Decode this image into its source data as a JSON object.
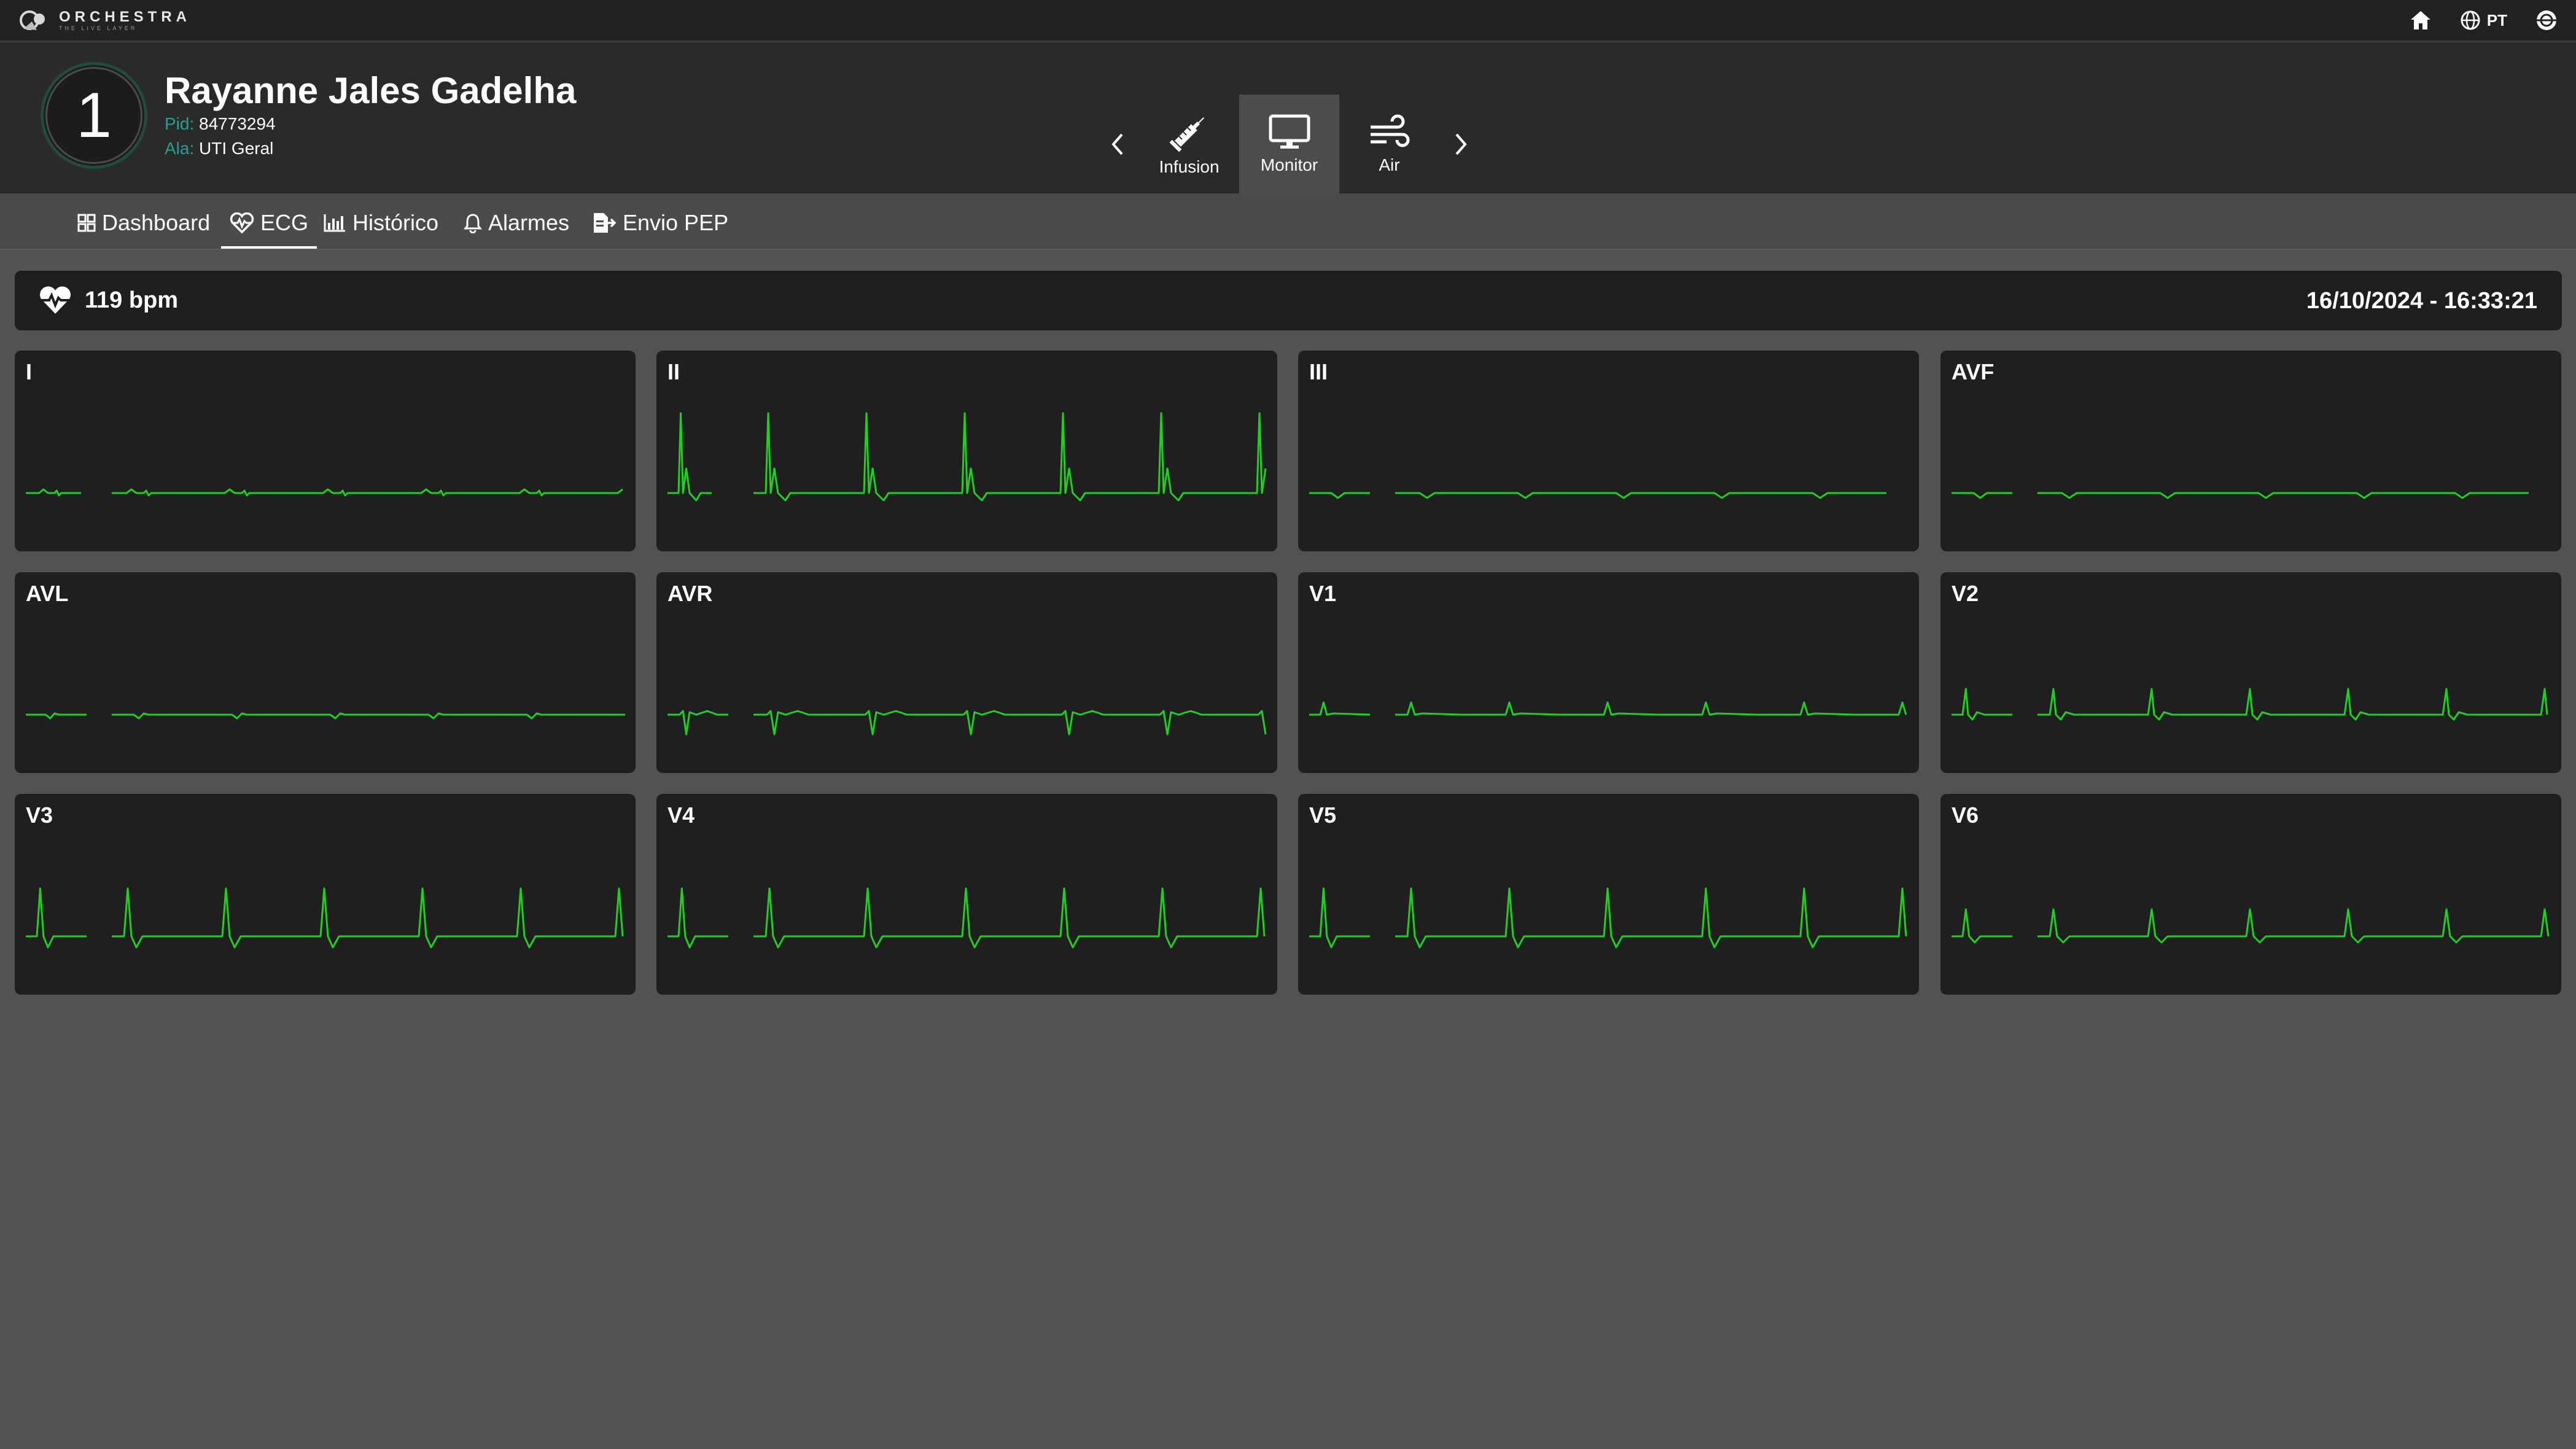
{
  "app": {
    "brand": "ORCHESTRA",
    "brand_sub": "THE LIVE LAYER",
    "language": "PT"
  },
  "icons": {
    "home": "home-icon",
    "globe": "globe-icon",
    "user": "user-globe-icon",
    "heart": "heart-pulse-icon"
  },
  "colors": {
    "ecg_trace": "#1fd11f",
    "bed_ring": "#1f4d3a",
    "accent_label": "#2a9d8f"
  },
  "patient": {
    "bed_number": "1",
    "name": "Rayanne Jales Gadelha",
    "pid_label": "Pid:",
    "pid_value": "84773294",
    "ala_label": "Ala:",
    "ala_value": "UTI Geral"
  },
  "devices": [
    {
      "label": "Infusion",
      "icon": "syringe-icon",
      "active": false
    },
    {
      "label": "Monitor",
      "icon": "monitor-icon",
      "active": true
    },
    {
      "label": "Air",
      "icon": "wind-icon",
      "active": false
    }
  ],
  "tabs": [
    {
      "label": "Dashboard",
      "icon": "dashboard-grid-icon",
      "active": false
    },
    {
      "label": "ECG",
      "icon": "heart-pulse-icon",
      "active": true
    },
    {
      "label": "Histórico",
      "icon": "bar-chart-icon",
      "active": false
    },
    {
      "label": "Alarmes",
      "icon": "bell-icon",
      "active": false
    },
    {
      "label": "Envio PEP",
      "icon": "file-export-icon",
      "active": false
    }
  ],
  "heart_rate": {
    "text": "119 bpm",
    "timestamp": "16/10/2024 - 16:33:21"
  },
  "leads": [
    {
      "label": "I",
      "shape": "lowP"
    },
    {
      "label": "II",
      "shape": "tall"
    },
    {
      "label": "III",
      "shape": "flatNeg"
    },
    {
      "label": "AVF",
      "shape": "flatNeg"
    },
    {
      "label": "AVL",
      "shape": "flatAVL"
    },
    {
      "label": "AVR",
      "shape": "avr"
    },
    {
      "label": "V1",
      "shape": "v1"
    },
    {
      "label": "V2",
      "shape": "v2"
    },
    {
      "label": "V3",
      "shape": "v3"
    },
    {
      "label": "V4",
      "shape": "v3"
    },
    {
      "label": "V5",
      "shape": "v3"
    },
    {
      "label": "V6",
      "shape": "v6"
    }
  ]
}
